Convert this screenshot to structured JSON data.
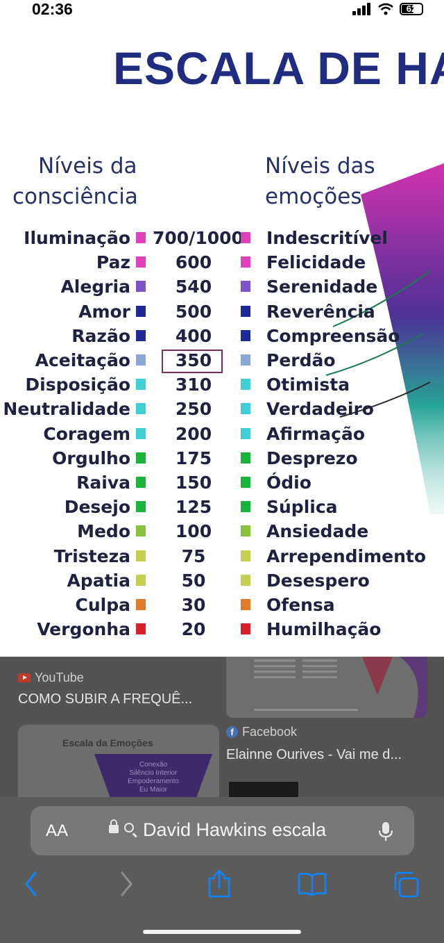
{
  "status_bar": {
    "time": "02:36",
    "battery": "62",
    "battery_level": 0.62
  },
  "image": {
    "title": "ESCALA DE HA",
    "left_header_line1": "Níveis da",
    "left_header_line2": "consciência",
    "right_header_line1": "Níveis das",
    "right_header_line2": "emoções",
    "levels": [
      {
        "consciousness": "Iluminação",
        "value": "700/1000",
        "emotion": "Indescritível",
        "color": "#e040b8"
      },
      {
        "consciousness": "Paz",
        "value": "600",
        "emotion": "Felicidade",
        "color": "#e040b8"
      },
      {
        "consciousness": "Alegria",
        "value": "540",
        "emotion": "Serenidade",
        "color": "#7b55c8"
      },
      {
        "consciousness": "Amor",
        "value": "500",
        "emotion": "Reverência",
        "color": "#1e2a9a"
      },
      {
        "consciousness": "Razão",
        "value": "400",
        "emotion": "Compreensão",
        "color": "#1e2a9a"
      },
      {
        "consciousness": "Aceitação",
        "value": "350",
        "emotion": "Perdão",
        "color": "#8aa6d6"
      },
      {
        "consciousness": "Disposição",
        "value": "310",
        "emotion": "Otimista",
        "color": "#3ed0d6"
      },
      {
        "consciousness": "Neutralidade",
        "value": "250",
        "emotion": "Verdadeiro",
        "color": "#3ed0d6"
      },
      {
        "consciousness": "Coragem",
        "value": "200",
        "emotion": "Afirmação",
        "color": "#3ed0d6"
      },
      {
        "consciousness": "Orgulho",
        "value": "175",
        "emotion": "Desprezo",
        "color": "#19b43c"
      },
      {
        "consciousness": "Raiva",
        "value": "150",
        "emotion": "Ódio",
        "color": "#19b43c"
      },
      {
        "consciousness": "Desejo",
        "value": "125",
        "emotion": "Súplica",
        "color": "#19b43c"
      },
      {
        "consciousness": "Medo",
        "value": "100",
        "emotion": "Ansiedade",
        "color": "#88c13a"
      },
      {
        "consciousness": "Tristeza",
        "value": "75",
        "emotion": "Arrependimento",
        "color": "#c6d050"
      },
      {
        "consciousness": "Apatia",
        "value": "50",
        "emotion": "Desespero",
        "color": "#c6d050"
      },
      {
        "consciousness": "Culpa",
        "value": "30",
        "emotion": "Ofensa",
        "color": "#e07a2a"
      },
      {
        "consciousness": "Vergonha",
        "value": "20",
        "emotion": "Humilhação",
        "color": "#d8202a"
      }
    ]
  },
  "results": {
    "youtube": {
      "source": "YouTube",
      "title": "COMO SUBIR A FREQUÊ..."
    },
    "facebook": {
      "source": "Facebook",
      "title": "Elainne Ourives - Vai me d..."
    },
    "thumb_title": "Escala da Emoções",
    "thumb_funnel_text": "Conexão\nSilêncio Interior\nEmpoderamento\nEu Maior"
  },
  "toolbar": {
    "aa_label": "AA",
    "query": "David Hawkins escala"
  },
  "colors": {
    "title_blue": "#1f2c80",
    "overlay": "#535353",
    "toolbar": "#5b5b5b",
    "icon_blue": "#0a84ff"
  },
  "icons": [
    "signal-icon",
    "wifi-icon",
    "battery-icon",
    "lock-icon",
    "search-icon",
    "mic-icon",
    "back-icon",
    "forward-icon",
    "share-icon",
    "bookmarks-icon",
    "tabs-icon",
    "youtube-icon",
    "facebook-icon"
  ]
}
